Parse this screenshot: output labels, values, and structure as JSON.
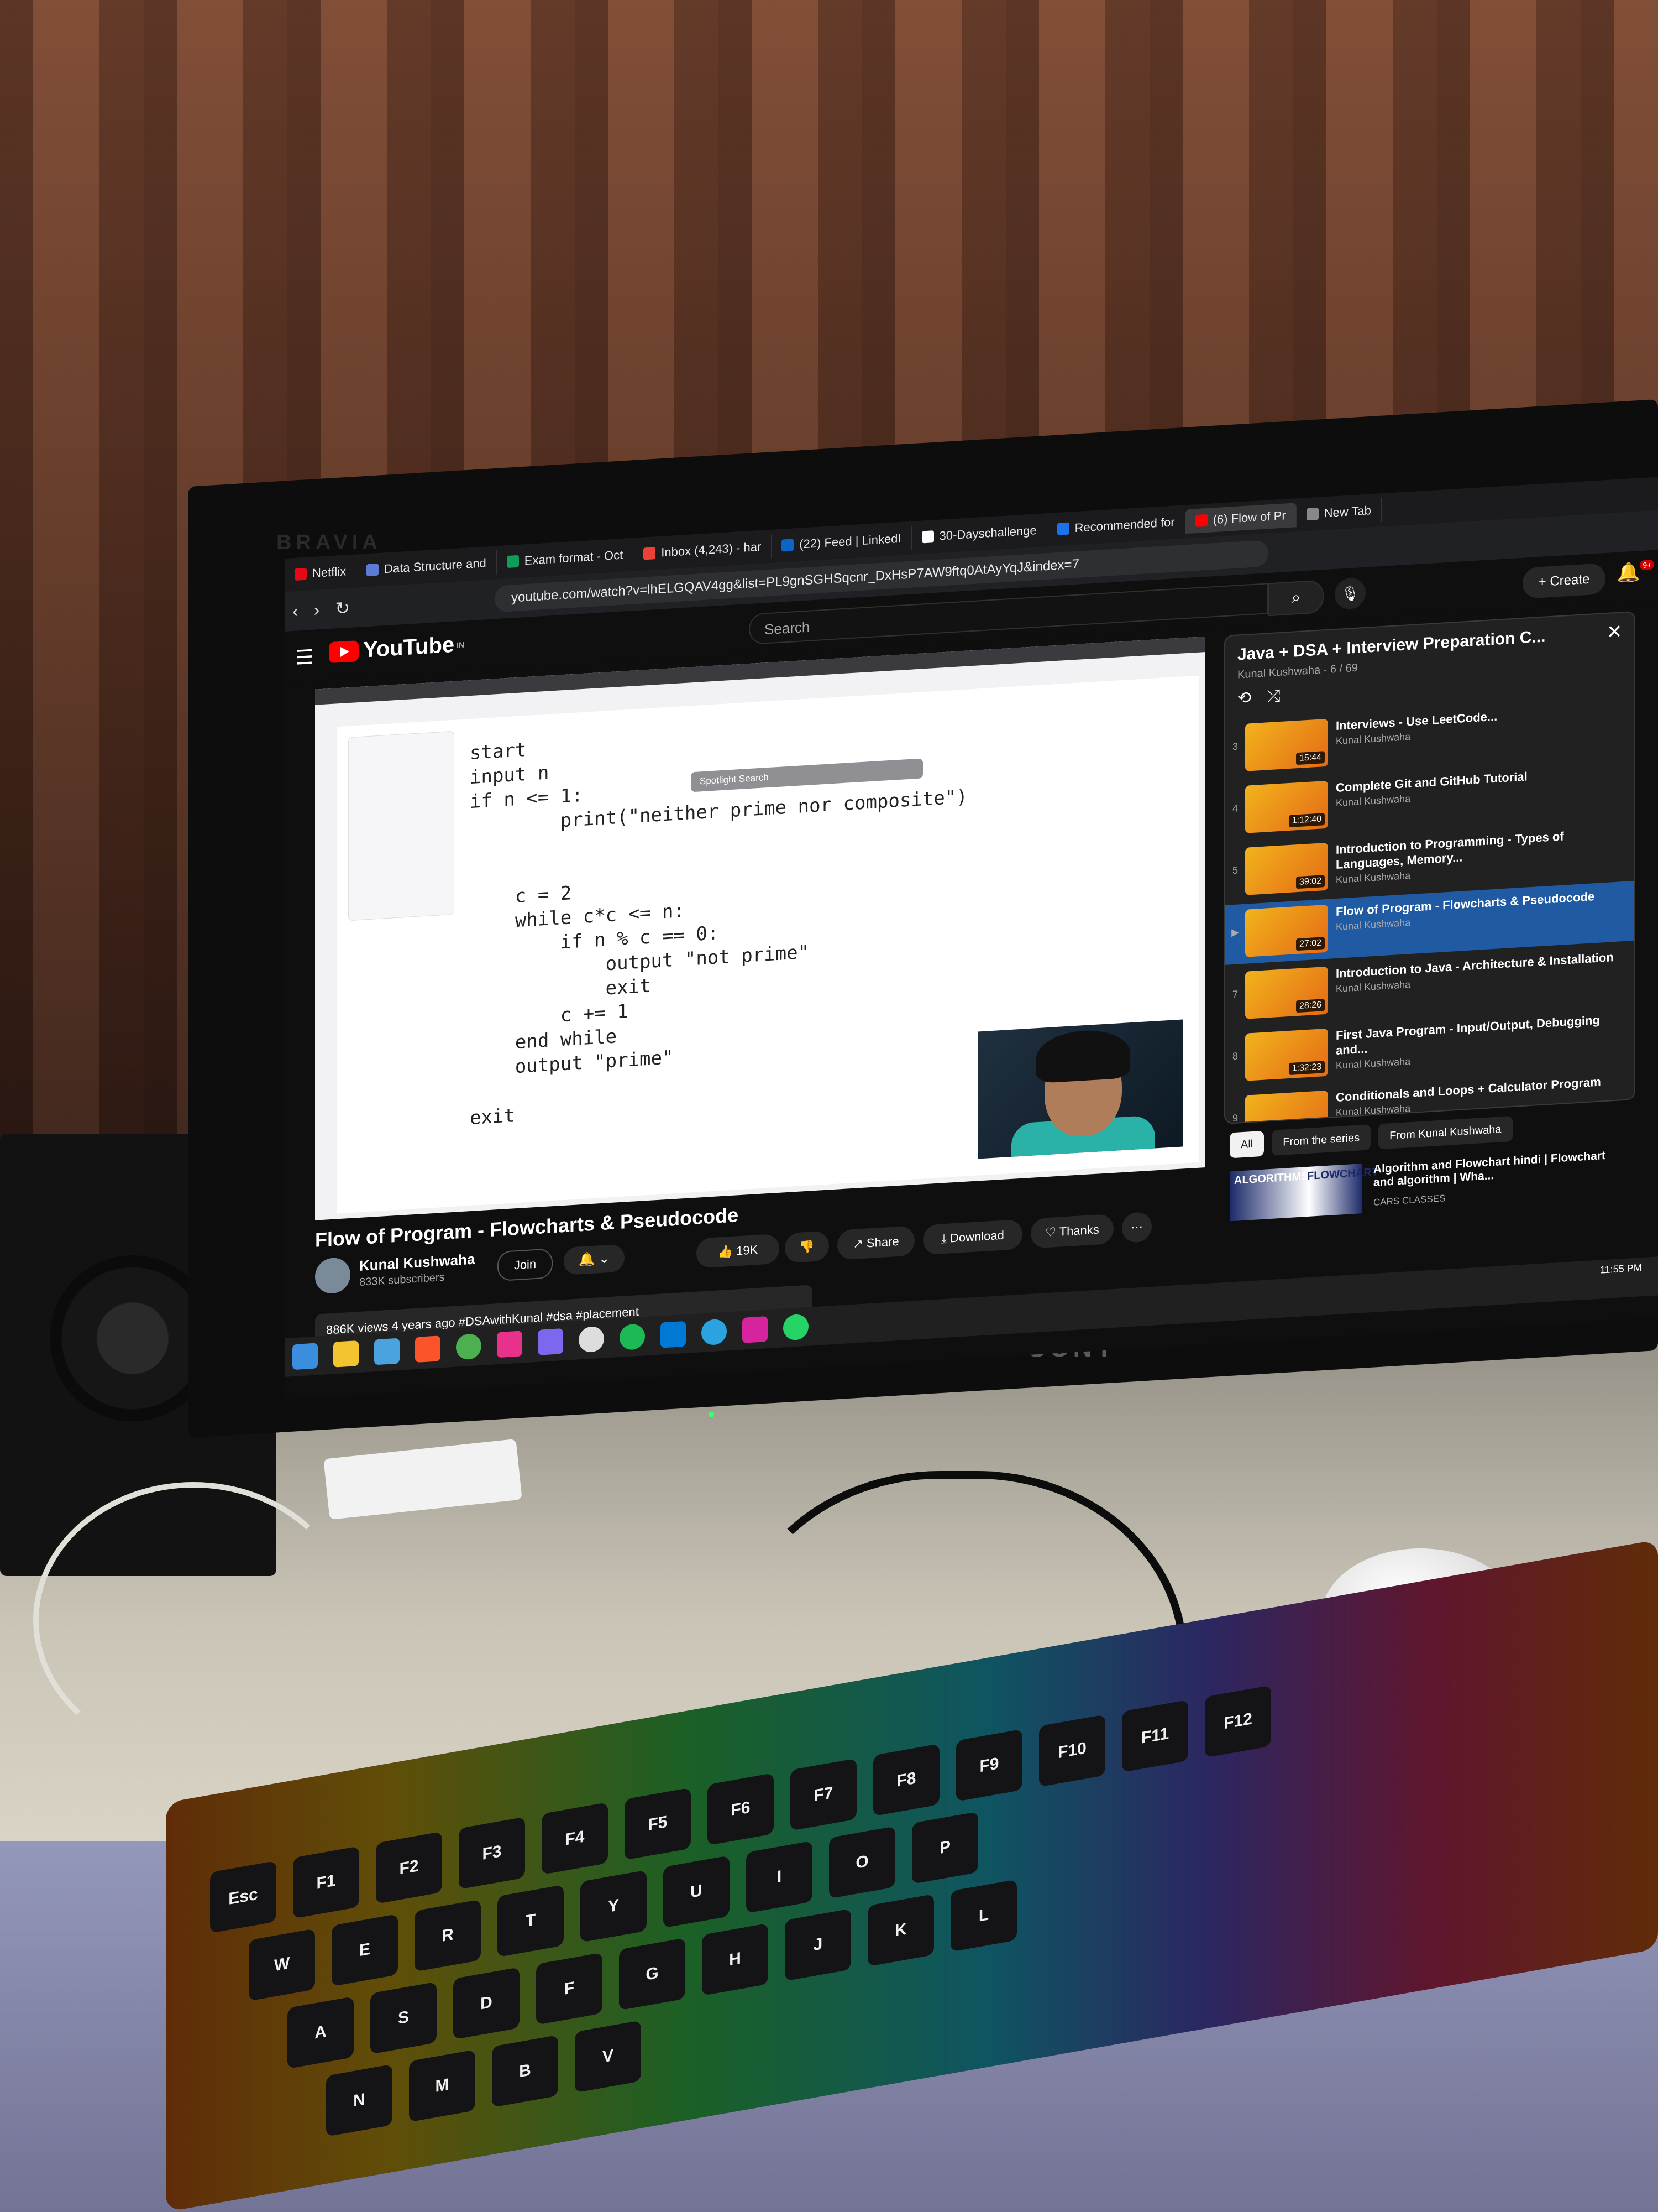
{
  "monitor": {
    "brand_top": "BRAVIA",
    "brand_bottom": "SONY"
  },
  "browser": {
    "tabs": [
      {
        "label": "Netflix",
        "color": "#e50914"
      },
      {
        "label": "Data Structure and",
        "color": "#5b7bd5"
      },
      {
        "label": "Exam format - Oct",
        "color": "#0f9d58"
      },
      {
        "label": "Inbox (4,243) - har",
        "color": "#ea4335"
      },
      {
        "label": "(22) Feed | LinkedI",
        "color": "#0a66c2"
      },
      {
        "label": "30-Dayschallenge",
        "color": "#ffffff"
      },
      {
        "label": "Recommended for",
        "color": "#1a73e8"
      },
      {
        "label": "(6) Flow of Pr",
        "color": "#ff0000",
        "active": true
      },
      {
        "label": "New Tab",
        "color": "#888888"
      }
    ],
    "url": "youtube.com/watch?v=lhELGQAV4gg&list=PL9gnSGHSqcnr_DxHsP7AW9ftq0AtAyYqJ&index=7"
  },
  "youtube": {
    "logo": "YouTube",
    "country": "IN",
    "search_placeholder": "Search",
    "create_label": "Create",
    "notification_count": "9+",
    "video": {
      "title": "Flow of Program - Flowcharts & Pseudocode",
      "channel": "Kunal Kushwaha",
      "subscribers": "833K subscribers",
      "join_label": "Join",
      "likes": "19K",
      "share_label": "Share",
      "download_label": "Download",
      "thanks_label": "Thanks",
      "meta": "886K views  4 years ago  #DSAwithKunal #dsa #placement",
      "spotlight": "Spotlight Search",
      "code_lines": [
        "start",
        "input n",
        "if n <= 1:",
        "        print(\"neither prime nor composite\")",
        "",
        "",
        "    c = 2",
        "    while c*c <= n:",
        "        if n % c == 0:",
        "            output \"not prime\"",
        "            exit",
        "        c += 1",
        "    end while",
        "    output \"prime\"",
        "",
        "exit"
      ]
    },
    "playlist": {
      "title": "Java + DSA + Interview Preparation C...",
      "subtitle": "Kunal Kushwaha - 6 / 69",
      "items": [
        {
          "num": "3",
          "title": "Interviews - Use LeetCode...",
          "channel": "Kunal Kushwaha",
          "duration": "15:44"
        },
        {
          "num": "4",
          "title": "Complete Git and GitHub Tutorial",
          "channel": "Kunal Kushwaha",
          "duration": "1:12:40"
        },
        {
          "num": "5",
          "title": "Introduction to Programming - Types of Languages, Memory...",
          "channel": "Kunal Kushwaha",
          "duration": "39:02"
        },
        {
          "num": "▶",
          "title": "Flow of Program - Flowcharts & Pseudocode",
          "channel": "Kunal Kushwaha",
          "duration": "27:02",
          "active": true
        },
        {
          "num": "7",
          "title": "Introduction to Java - Architecture & Installation",
          "channel": "Kunal Kushwaha",
          "duration": "28:26"
        },
        {
          "num": "8",
          "title": "First Java Program - Input/Output, Debugging and...",
          "channel": "Kunal Kushwaha",
          "duration": "1:32:23"
        },
        {
          "num": "9",
          "title": "Conditionals and Loops + Calculator Program",
          "channel": "Kunal Kushwaha",
          "duration": ""
        }
      ]
    },
    "chips": [
      "All",
      "From the series",
      "From Kunal Kushwaha"
    ],
    "recommended": {
      "thumb_label": "ALGORITHMS",
      "thumb_label2": "FLOWCHART",
      "title": "Algorithm and Flowchart hindi | Flowchart and algorithm | Wha...",
      "channel": "CARS CLASSES"
    }
  },
  "taskbar": {
    "time": "11:55 PM"
  },
  "keyboard": {
    "keys": [
      "Esc",
      "F1",
      "F2",
      "F3",
      "F4",
      "F5",
      "F6",
      "F7",
      "F8",
      "F9",
      "F10",
      "F11",
      "F12",
      "W",
      "E",
      "R",
      "T",
      "Y",
      "U",
      "I",
      "O",
      "P",
      "A",
      "S",
      "D",
      "F",
      "G",
      "H",
      "J",
      "K",
      "L",
      "N",
      "M",
      "B",
      "V"
    ]
  }
}
